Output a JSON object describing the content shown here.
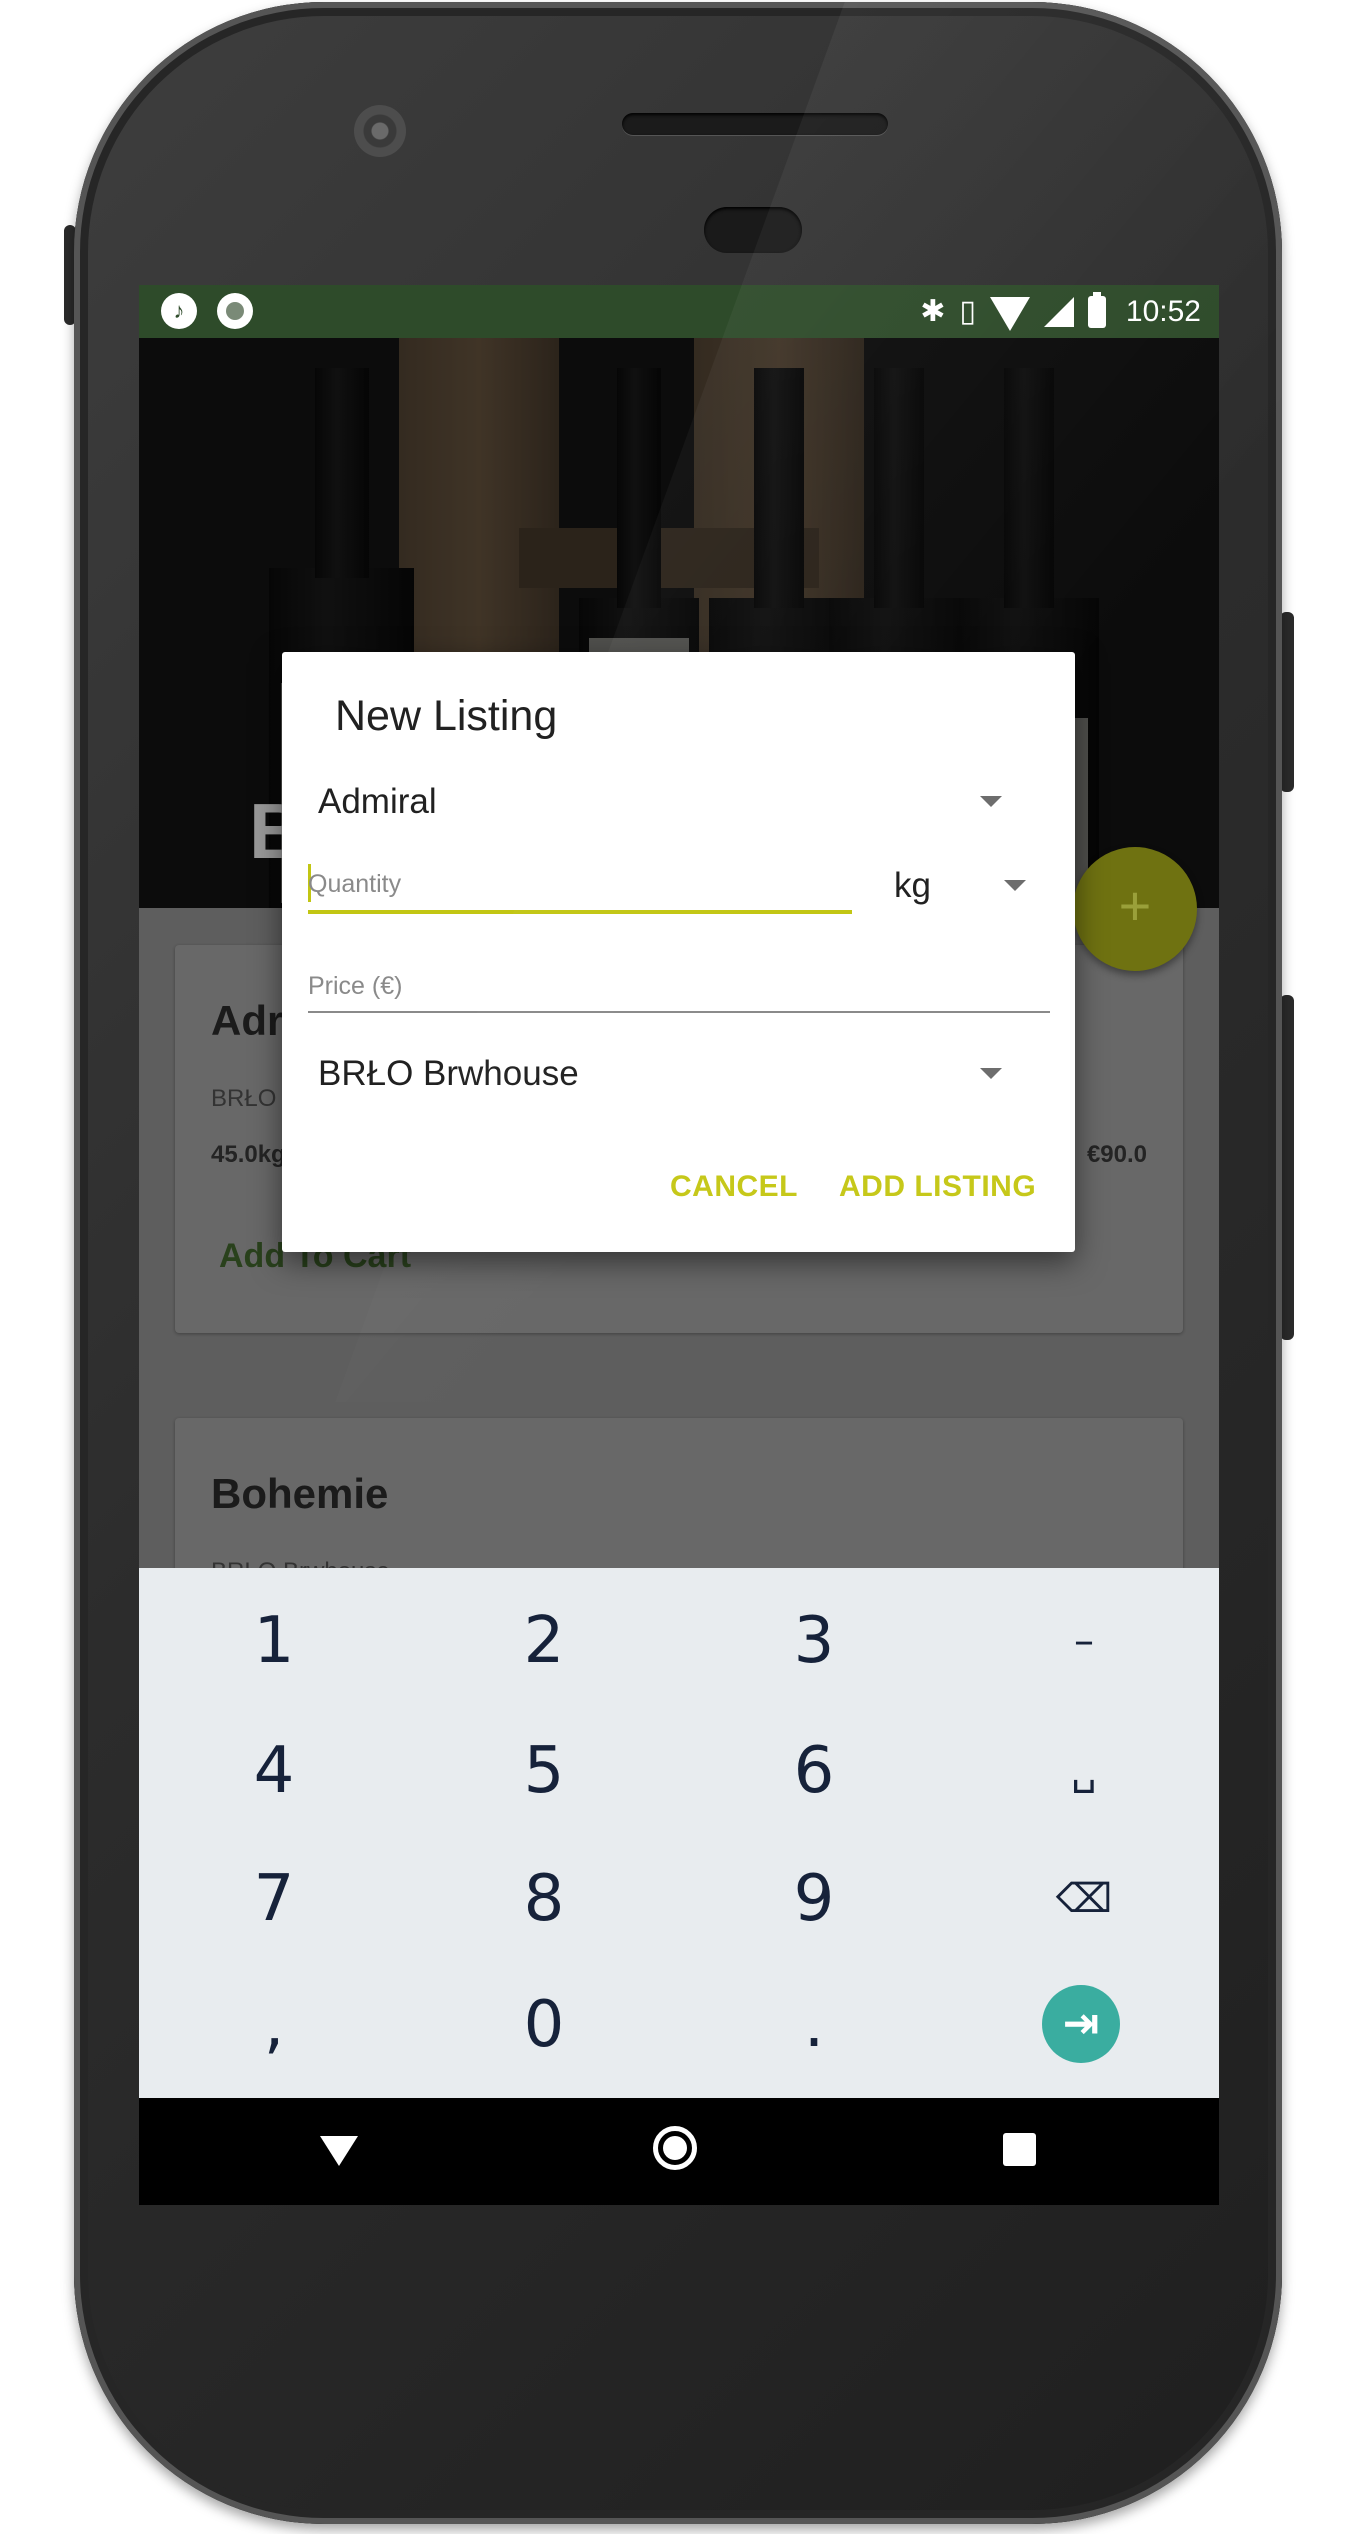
{
  "status_bar": {
    "time": "10:52",
    "left_icons": [
      "music-note-icon",
      "record-icon"
    ],
    "right_icons": [
      "bluetooth-icon",
      "vibrate-icon",
      "wifi-icon",
      "cell-signal-icon",
      "battery-charging-icon"
    ]
  },
  "background": {
    "hero_letter": "B",
    "cards": [
      {
        "title": "Adr",
        "brewery": "BRŁO",
        "quantity": "45.0kg",
        "price": "€90.0",
        "action": "Add To Cart"
      },
      {
        "title": "Bohemie",
        "brewery": "BRŁO Brwhouse"
      }
    ],
    "fab_label": "+"
  },
  "dialog": {
    "title": "New Listing",
    "product_spinner": {
      "selected": "Admiral"
    },
    "quantity": {
      "placeholder": "Quantity",
      "value": ""
    },
    "unit_spinner": {
      "selected": "kg"
    },
    "price": {
      "placeholder": "Price (€)",
      "value": ""
    },
    "brewery_spinner": {
      "selected": "BRŁO Brwhouse"
    },
    "cancel_label": "CANCEL",
    "submit_label": "ADD LISTING"
  },
  "colors": {
    "accent": "#c6c81a",
    "status_bar": "#2e4b2a",
    "keyboard_bg": "#e8ecef",
    "enter_key": "#3aada0"
  },
  "keyboard": {
    "row1": [
      "1",
      "2",
      "3",
      "–"
    ],
    "row2": [
      "4",
      "5",
      "6",
      "␣"
    ],
    "row3": [
      "7",
      "8",
      "9",
      "⌫"
    ],
    "row4": [
      ",",
      "0",
      ".",
      "⇥"
    ]
  },
  "nav_bar": {
    "icons": [
      "back-icon",
      "home-icon",
      "recents-icon"
    ]
  }
}
